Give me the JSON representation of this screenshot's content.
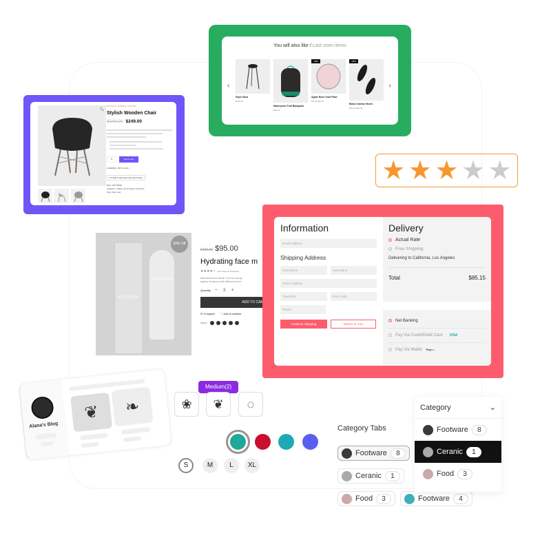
{
  "recommendations": {
    "title_main": "You will also like / ",
    "title_sub": "Last seen items",
    "prev_icon": "chevron-left-icon",
    "next_icon": "chevron-right-icon",
    "items": [
      {
        "name": "Stylo Stool",
        "price": "$100.00",
        "badge": ""
      },
      {
        "name": "Waterproof Troll Backpack",
        "price": "$39.00",
        "badge": ""
      },
      {
        "name": "Agate Rose Gold Plate",
        "price": "$15.00 $8.00",
        "badge": "-48%"
      },
      {
        "name": "Black Canvas Shoes",
        "price": "$49.00 $35.00",
        "badge": "-28%"
      }
    ]
  },
  "chair_product": {
    "category": "STOOLS, DINING CHAIRS",
    "title": "Stylish Wooden Chair",
    "old_price": "$349.00",
    "price": "$249.00",
    "qty": "1",
    "add_button": "Add to cart",
    "availability": "Availability: 496 in stock",
    "notice": "27 Sold In last hour! Get yours Now.",
    "sku": "SKU: PDT78632",
    "categories": "Category: Chairs, Home Decor, Furniture",
    "tags": "Tag: chair, cozy"
  },
  "rating": {
    "value": 3,
    "max": 5,
    "active_color": "#f7962f",
    "inactive_color": "#cccccc"
  },
  "cream_product": {
    "discount": "50% Off",
    "brand": "KYLIESKIN",
    "old_price": "$190.00",
    "price": "$95.00",
    "title": "Hydrating face m",
    "stars": "★★★★☆",
    "reviews": "(10 Customer Reviews)",
    "desc_1": "Niacinamide and Vitamin C are two anti-ag",
    "desc_2": "together because of their different pH leve",
    "qty_label": "Quantity",
    "qty": "3",
    "minus": "−",
    "plus": "+",
    "add_to_cart": "ADD TO CART",
    "compare": "Compare",
    "wishlist": "Add to wishlist",
    "share": "Share :"
  },
  "checkout": {
    "info_title": "Information",
    "email_placeholder": "Email Address",
    "shipping_title": "Shipping Address",
    "first_name": "First Name",
    "last_name": "Last Name",
    "street": "Street Address",
    "city": "Town/City",
    "post_code": "Post Code",
    "phone": "Phone",
    "continue_btn": "Continue Shipping",
    "return_btn": "Return to Cart",
    "delivery_title": "Delivery",
    "actual_rate": "Actual Rate",
    "free_shipping": "Free Shipping",
    "delivering_to": "Delivering to California, Los Angeles",
    "total_label": "Total",
    "total_value": "$85.15",
    "net_banking": "Net Banking",
    "card": "Pay Via Credit/Debit Card",
    "card_brand": "VISA",
    "wallet": "Pay Via Wallet",
    "wallet_brand_a": "Pay",
    "wallet_brand_b": "tm",
    "accent": "#fd5c6d"
  },
  "blog": {
    "name": "Alana's Blog"
  },
  "swatches": {
    "tooltip": "Medium(2)",
    "colors": [
      "#21a89a",
      "#c8102e",
      "#1fa9b5",
      "#5b5ff0"
    ],
    "selected_color": 0,
    "sizes": [
      "S",
      "M",
      "L",
      "XL"
    ],
    "selected_size": "S"
  },
  "category_tabs": {
    "title": "Category Tabs",
    "chips": [
      {
        "label": "Footware",
        "count": "8"
      },
      {
        "label": "Ceranic",
        "count": "1"
      },
      {
        "label": "Food",
        "count": "3"
      },
      {
        "label": "Footware",
        "count": "4"
      }
    ],
    "dropdown": {
      "label": "Category",
      "items": [
        {
          "label": "Footware",
          "count": "8"
        },
        {
          "label": "Ceranic",
          "count": "1"
        },
        {
          "label": "Food",
          "count": "3"
        }
      ]
    }
  }
}
